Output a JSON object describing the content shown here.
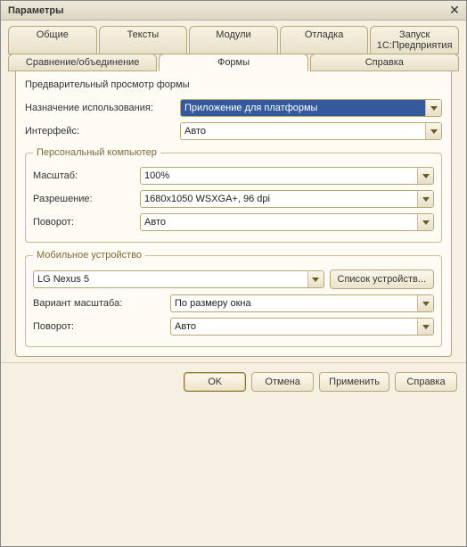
{
  "window": {
    "title": "Параметры"
  },
  "tabs": {
    "row1": [
      {
        "label": "Общие"
      },
      {
        "label": "Тексты"
      },
      {
        "label": "Модули"
      },
      {
        "label": "Отладка"
      },
      {
        "label": "Запуск 1С:Предприятия"
      }
    ],
    "row2": [
      {
        "label": "Сравнение/объединение"
      },
      {
        "label": "Формы",
        "active": true
      },
      {
        "label": "Справка"
      }
    ]
  },
  "form_preview": {
    "heading": "Предварительный просмотр формы",
    "purpose_label": "Назначение использования:",
    "purpose_value": "Приложение для платформы",
    "interface_label": "Интерфейс:",
    "interface_value": "Авто"
  },
  "pc_group": {
    "legend": "Персональный компьютер",
    "scale_label": "Масштаб:",
    "scale_value": "100%",
    "resolution_label": "Разрешение:",
    "resolution_value": "1680x1050 WSXGA+, 96 dpi",
    "rotation_label": "Поворот:",
    "rotation_value": "Авто"
  },
  "mobile_group": {
    "legend": "Мобильное устройство",
    "device_value": "LG Nexus 5",
    "device_list_btn": "Список устройств...",
    "scale_variant_label": "Вариант масштаба:",
    "scale_variant_value": "По размеру окна",
    "rotation_label": "Поворот:",
    "rotation_value": "Авто"
  },
  "buttons": {
    "ok": "OK",
    "cancel": "Отмена",
    "apply": "Применить",
    "help": "Справка"
  }
}
